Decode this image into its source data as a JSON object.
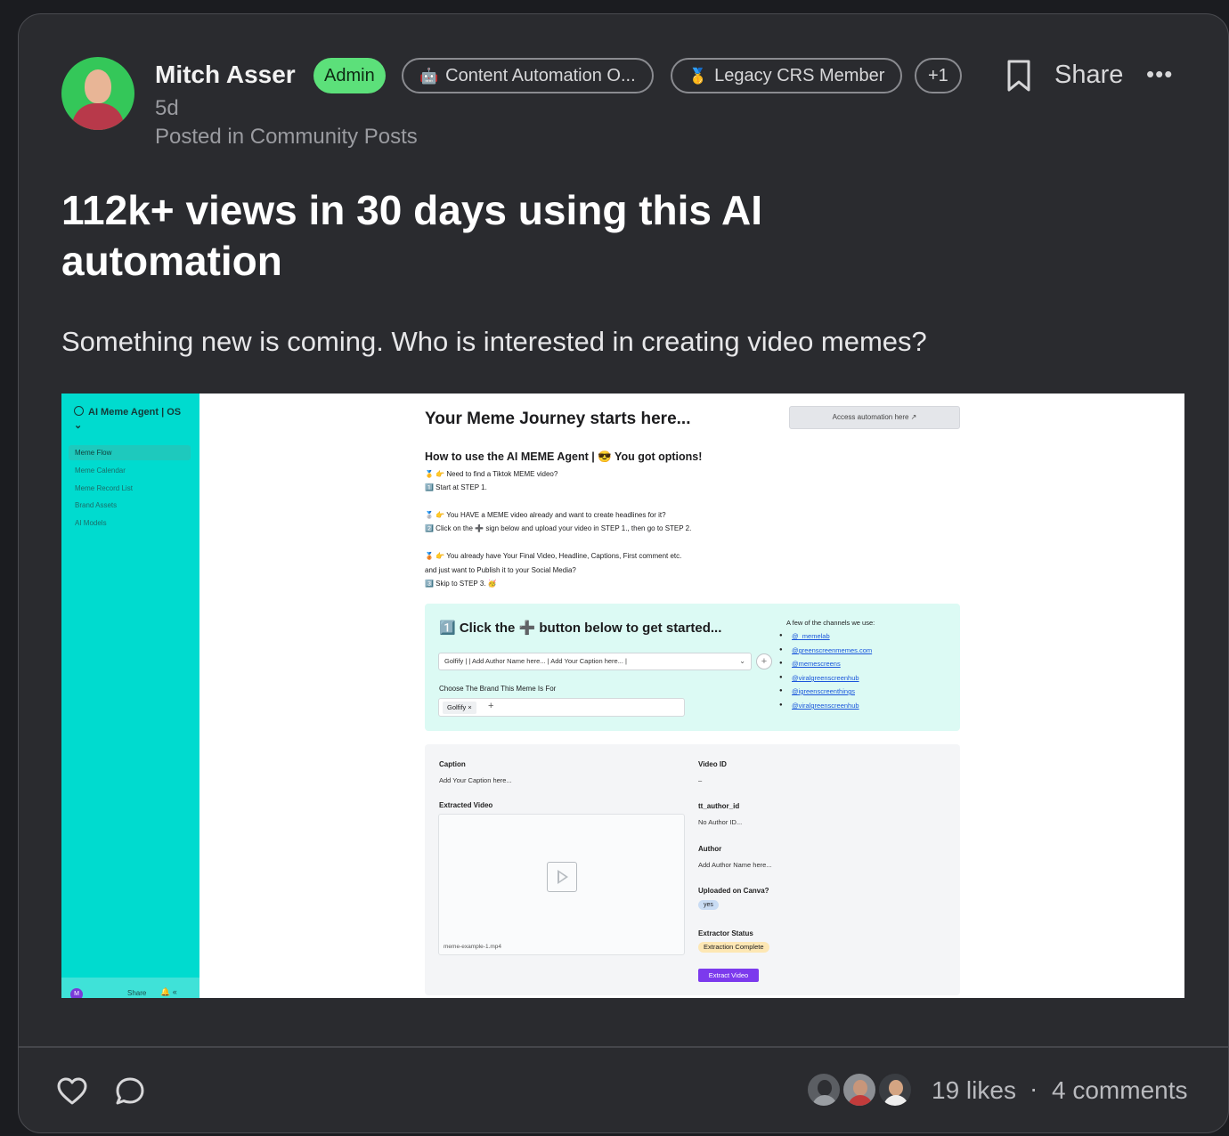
{
  "post": {
    "author": "Mitch Asser",
    "role_badge": "Admin",
    "tags": [
      {
        "icon": "robot-icon",
        "label": "Content Automation O..."
      },
      {
        "icon": "medal-icon",
        "label": "Legacy CRS Member"
      },
      {
        "icon": null,
        "label": "+1"
      }
    ],
    "time": "5d",
    "posted_in_prefix": "Posted in",
    "posted_in": "Community Posts",
    "share_label": "Share",
    "more_label": "•••",
    "title": "112k+ views in 30 days using this AI automation",
    "body": "Something new is coming. Who is interested in creating video memes?"
  },
  "screenshot": {
    "sidebar": {
      "app_name": "AI Meme Agent | OS ⌄",
      "items": [
        "Meme Flow",
        "Meme Calendar",
        "Meme Record List",
        "Brand Assets",
        "AI Models"
      ],
      "footer_avatar": "M",
      "footer_share": "Share",
      "footer_icons": "🔔 «"
    },
    "heading": "Your Meme Journey starts here...",
    "access_button": "Access automation here ↗",
    "howto_heading": "How to use the AI MEME Agent | 😎 You got options!",
    "lines": [
      "🥇 👉 Need to find a Tiktok MEME video?",
      "1️⃣ Start at STEP 1.",
      "🥈 👉 You HAVE a MEME video already and want to create headlines for it?",
      "2️⃣ Click on the ➕ sign below and upload your video in STEP 1., then go to STEP 2.",
      "🥉 👉 You already have Your Final Video, Headline, Captions, First comment etc.",
      "and just want to Publish it to your Social Media?",
      "3️⃣ Skip to STEP 3. 🥳"
    ],
    "step1": {
      "heading": "1️⃣ Click the ➕ button below to get started...",
      "select_value": "Golfify | | Add Author Name here... | Add Your Caption here... |",
      "brand_label": "Choose The Brand This Meme Is For",
      "brand_chip": "Golfify ×",
      "channels_label": "A few of the channels we use:",
      "channels": [
        "@_memelab",
        "@greenscreenmemes.com",
        "@memescreens",
        "@viralgreenscreenhub",
        "@igreenscreenthings",
        "@viralgreenscreenhub"
      ]
    },
    "record": {
      "caption_label": "Caption",
      "caption_value": "Add Your Caption here...",
      "extracted_label": "Extracted Video",
      "video_filename": "meme-example-1.mp4",
      "video_id_label": "Video ID",
      "video_id_value": "–",
      "author_id_label": "tt_author_id",
      "author_id_value": "No Author ID...",
      "author_label": "Author",
      "author_value": "Add Author Name here...",
      "canva_label": "Uploaded on Canva?",
      "canva_value": "yes",
      "status_label": "Extractor Status",
      "status_value": "Extraction Complete",
      "extract_button": "Extract Video"
    }
  },
  "footer": {
    "likes": "19 likes",
    "separator": "·",
    "comments": "4 comments"
  },
  "colors": {
    "card_bg": "#2a2b2f",
    "admin_badge": "#5ce07a",
    "sidebar_teal": "#00dbcf",
    "extract_purple": "#7c3aed"
  }
}
